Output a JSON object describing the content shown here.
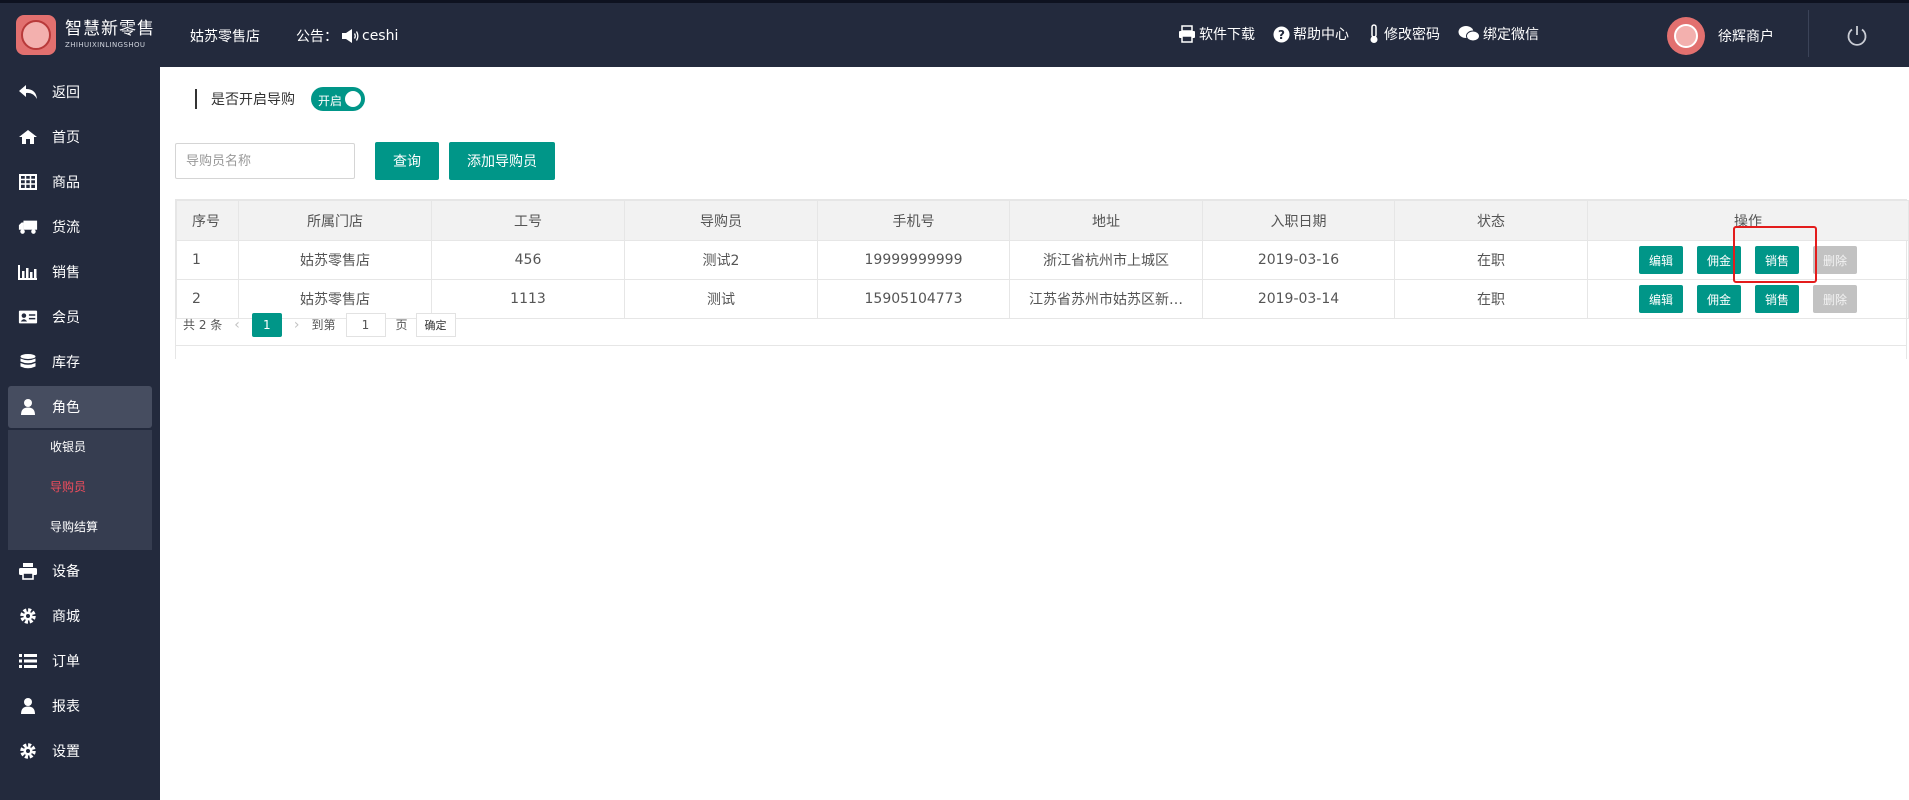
{
  "brand": {
    "name_cn": "智慧新零售",
    "name_en": "ZHIHUIXINLINGSHOU"
  },
  "header": {
    "store": "姑苏零售店",
    "notice_label": "公告：",
    "notice_text": "ceshi",
    "links": [
      {
        "label": "软件下载",
        "icon": "printer-icon"
      },
      {
        "label": "帮助中心",
        "icon": "help-icon"
      },
      {
        "label": "修改密码",
        "icon": "thermometer-icon"
      },
      {
        "label": "绑定微信",
        "icon": "wechat-icon"
      }
    ],
    "user": "徐辉商户"
  },
  "sidebar": {
    "items": [
      {
        "label": "返回",
        "icon": "back-icon"
      },
      {
        "label": "首页",
        "icon": "home-icon"
      },
      {
        "label": "商品",
        "icon": "table-icon"
      },
      {
        "label": "货流",
        "icon": "truck-icon"
      },
      {
        "label": "销售",
        "icon": "bar-chart-icon"
      },
      {
        "label": "会员",
        "icon": "id-card-icon"
      },
      {
        "label": "库存",
        "icon": "database-icon"
      },
      {
        "label": "角色",
        "icon": "user-icon"
      },
      {
        "label": "设备",
        "icon": "printer-icon"
      },
      {
        "label": "商城",
        "icon": "gear-icon"
      },
      {
        "label": "订单",
        "icon": "list-icon"
      },
      {
        "label": "报表",
        "icon": "user-icon"
      },
      {
        "label": "设置",
        "icon": "gear-icon"
      }
    ],
    "submenu": [
      "收银员",
      "导购员",
      "导购结算"
    ]
  },
  "main": {
    "toggle_label": "是否开启导购",
    "toggle_text": "开启",
    "search_placeholder": "导购员名称",
    "query_button": "查询",
    "add_button": "添加导购员",
    "columns": [
      "序号",
      "所属门店",
      "工号",
      "导购员",
      "手机号",
      "地址",
      "入职日期",
      "状态",
      "操作"
    ],
    "rows": [
      [
        "1",
        "姑苏零售店",
        "456",
        "测试2",
        "19999999999",
        "浙江省杭州市上城区",
        "2019-03-16",
        "在职"
      ],
      [
        "2",
        "姑苏零售店",
        "1113",
        "测试",
        "15905104773",
        "江苏省苏州市姑苏区新…",
        "2019-03-14",
        "在职"
      ]
    ],
    "ops": [
      "编辑",
      "佣金",
      "销售",
      "删除"
    ],
    "pager": {
      "total": "共 2 条",
      "current": "1",
      "goto_label": "到第",
      "goto_value": "1",
      "page_label": "页",
      "confirm": "确定"
    }
  },
  "colors": {
    "primary": "#009688",
    "sidebar": "#232a3d",
    "highlight": "#e31c1c",
    "active_sub": "#f14d5d"
  }
}
